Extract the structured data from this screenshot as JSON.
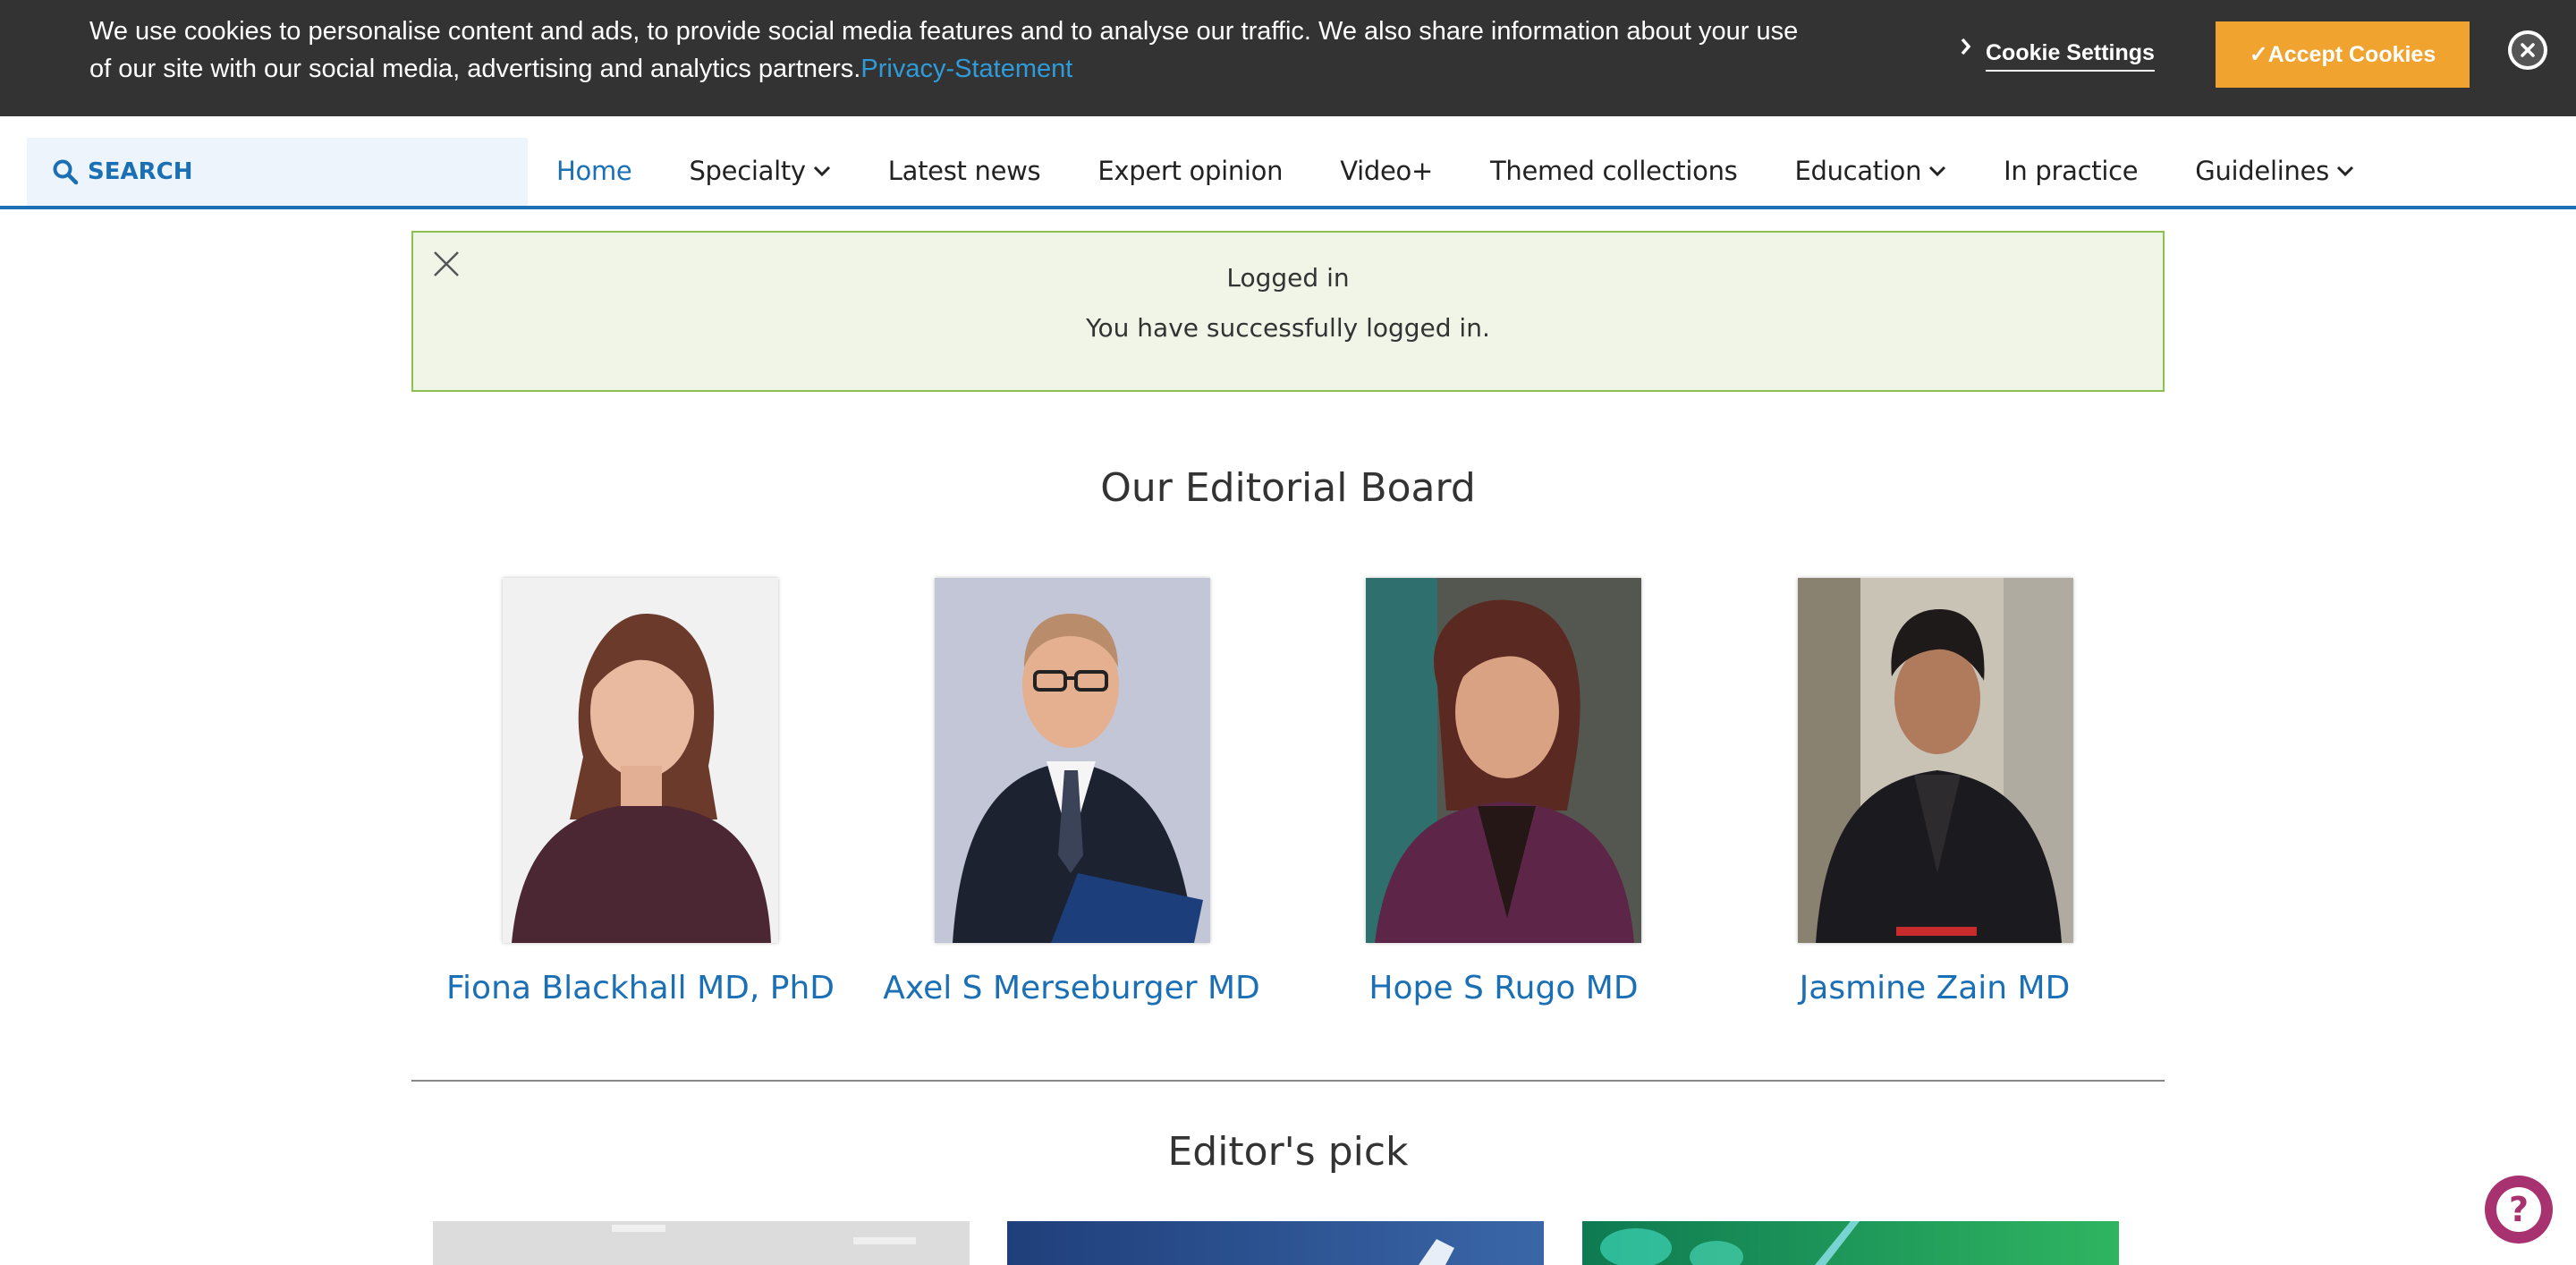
{
  "cookie_banner": {
    "text": "We use cookies to personalise content and ads, to provide social media features and to analyse our traffic. We also share information about your use of our site with our social media, advertising and analytics partners.",
    "privacy_link": "Privacy-Statement",
    "settings_label": "Cookie Settings",
    "accept_label": "✓Accept Cookies"
  },
  "nav": {
    "search_label": "SEARCH",
    "items": [
      {
        "label": "Home",
        "active": true,
        "dropdown": false
      },
      {
        "label": "Specialty",
        "dropdown": true
      },
      {
        "label": "Latest news",
        "dropdown": false
      },
      {
        "label": "Expert opinion",
        "dropdown": false
      },
      {
        "label": "Video+",
        "dropdown": false
      },
      {
        "label": "Themed collections",
        "dropdown": false
      },
      {
        "label": "Education",
        "dropdown": true
      },
      {
        "label": "In practice",
        "dropdown": false
      },
      {
        "label": "Guidelines",
        "dropdown": true
      }
    ]
  },
  "alert": {
    "title": "Logged in",
    "message": "You have successfully logged in."
  },
  "editorial_board": {
    "title": "Our Editorial Board",
    "members": [
      {
        "name": "Fiona Blackhall MD, PhD"
      },
      {
        "name": "Axel S Merseburger MD"
      },
      {
        "name": "Hope S Rugo MD"
      },
      {
        "name": "Jasmine Zain MD"
      }
    ]
  },
  "editors_pick": {
    "title": "Editor's pick"
  },
  "colors": {
    "accent": "#1a6fb5",
    "banner_bg": "#333333",
    "accept_btn": "#f0a32f",
    "alert_border": "#8cc152",
    "alert_bg": "#f0f5e8",
    "help_btn": "#a8326f"
  },
  "icons": {
    "search": "search-icon",
    "banner_close": "close-circle-icon",
    "alert_close": "close-icon",
    "caret": "chevron-down-icon",
    "help": "question-mark-icon"
  }
}
